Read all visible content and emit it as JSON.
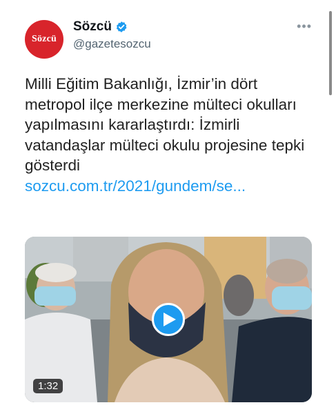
{
  "author": {
    "avatar_text": "Sözcü",
    "display_name": "Sözcü",
    "handle": "@gazetesozcu",
    "verified": true,
    "verified_icon": "verified-badge-icon"
  },
  "more_icon": "more-options-icon",
  "tweet": {
    "text": "Milli Eğitim Bakanlığı, İzmir’in dört metropol ilçe merkezine mülteci okulları yapılmasını kararlaştırdı: İzmirli vatandaşlar mülteci okulu projesine tepki gösterdi",
    "link": "sozcu.com.tr/2021/gundem/se..."
  },
  "media": {
    "type": "video",
    "duration": "1:32",
    "play_icon": "play-icon"
  },
  "colors": {
    "brand_red": "#d8242b",
    "link_blue": "#1d9bf0",
    "verified_blue": "#1d9bf0"
  }
}
